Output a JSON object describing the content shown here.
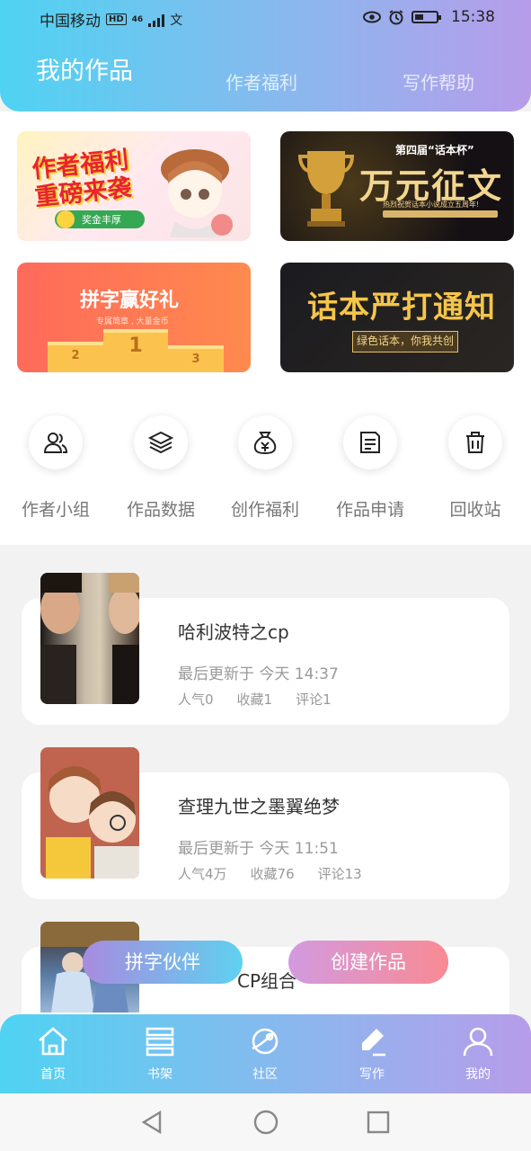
{
  "status": {
    "carrier": "中国移动",
    "hd": "HD",
    "net": "46",
    "time": "15:38"
  },
  "tabs": {
    "active": "我的作品",
    "t2": "作者福利",
    "t3": "写作帮助"
  },
  "banners": {
    "b1": {
      "line1": "作者福利",
      "line2": "重磅来袭",
      "tag": "奖金丰厚"
    },
    "b2": {
      "small": "第四届“话本杯”",
      "big": "万元征文",
      "sub": "热烈祝贺话本小说成立五周年!"
    },
    "b3": {
      "big": "拼字赢好礼",
      "sub": "专属简章 , 大量金币",
      "p1": "1",
      "p2": "2",
      "p3": "3"
    },
    "b4": {
      "big": "话本严打通知",
      "ribbon": "绿色话本，你我共创"
    }
  },
  "shortcuts": [
    {
      "label": "作者小组",
      "icon": "people-icon"
    },
    {
      "label": "作品数据",
      "icon": "layers-icon"
    },
    {
      "label": "创作福利",
      "icon": "money-bag-icon"
    },
    {
      "label": "作品申请",
      "icon": "document-icon"
    },
    {
      "label": "回收站",
      "icon": "trash-icon"
    }
  ],
  "works": [
    {
      "title": "哈利波特之cp",
      "updated": "最后更新于 今天 14:37",
      "popularity": "人气0",
      "favorites": "收藏1",
      "comments": "评论1"
    },
    {
      "title": "查理九世之墨翼绝梦",
      "updated": "最后更新于 今天 11:51",
      "popularity": "人气4万",
      "favorites": "收藏76",
      "comments": "评论13"
    },
    {
      "title": "CP组合",
      "updated": "",
      "popularity": "",
      "favorites": "",
      "comments": ""
    }
  ],
  "fabs": {
    "left": "拼字伙伴",
    "right": "创建作品"
  },
  "nav": [
    {
      "label": "首页",
      "icon": "home-icon"
    },
    {
      "label": "书架",
      "icon": "bookshelf-icon"
    },
    {
      "label": "社区",
      "icon": "planet-icon"
    },
    {
      "label": "写作",
      "icon": "pen-icon"
    },
    {
      "label": "我的",
      "icon": "profile-icon"
    }
  ],
  "colors": {
    "gradient_start": "#4fd3f2",
    "gradient_end": "#b79cea"
  }
}
